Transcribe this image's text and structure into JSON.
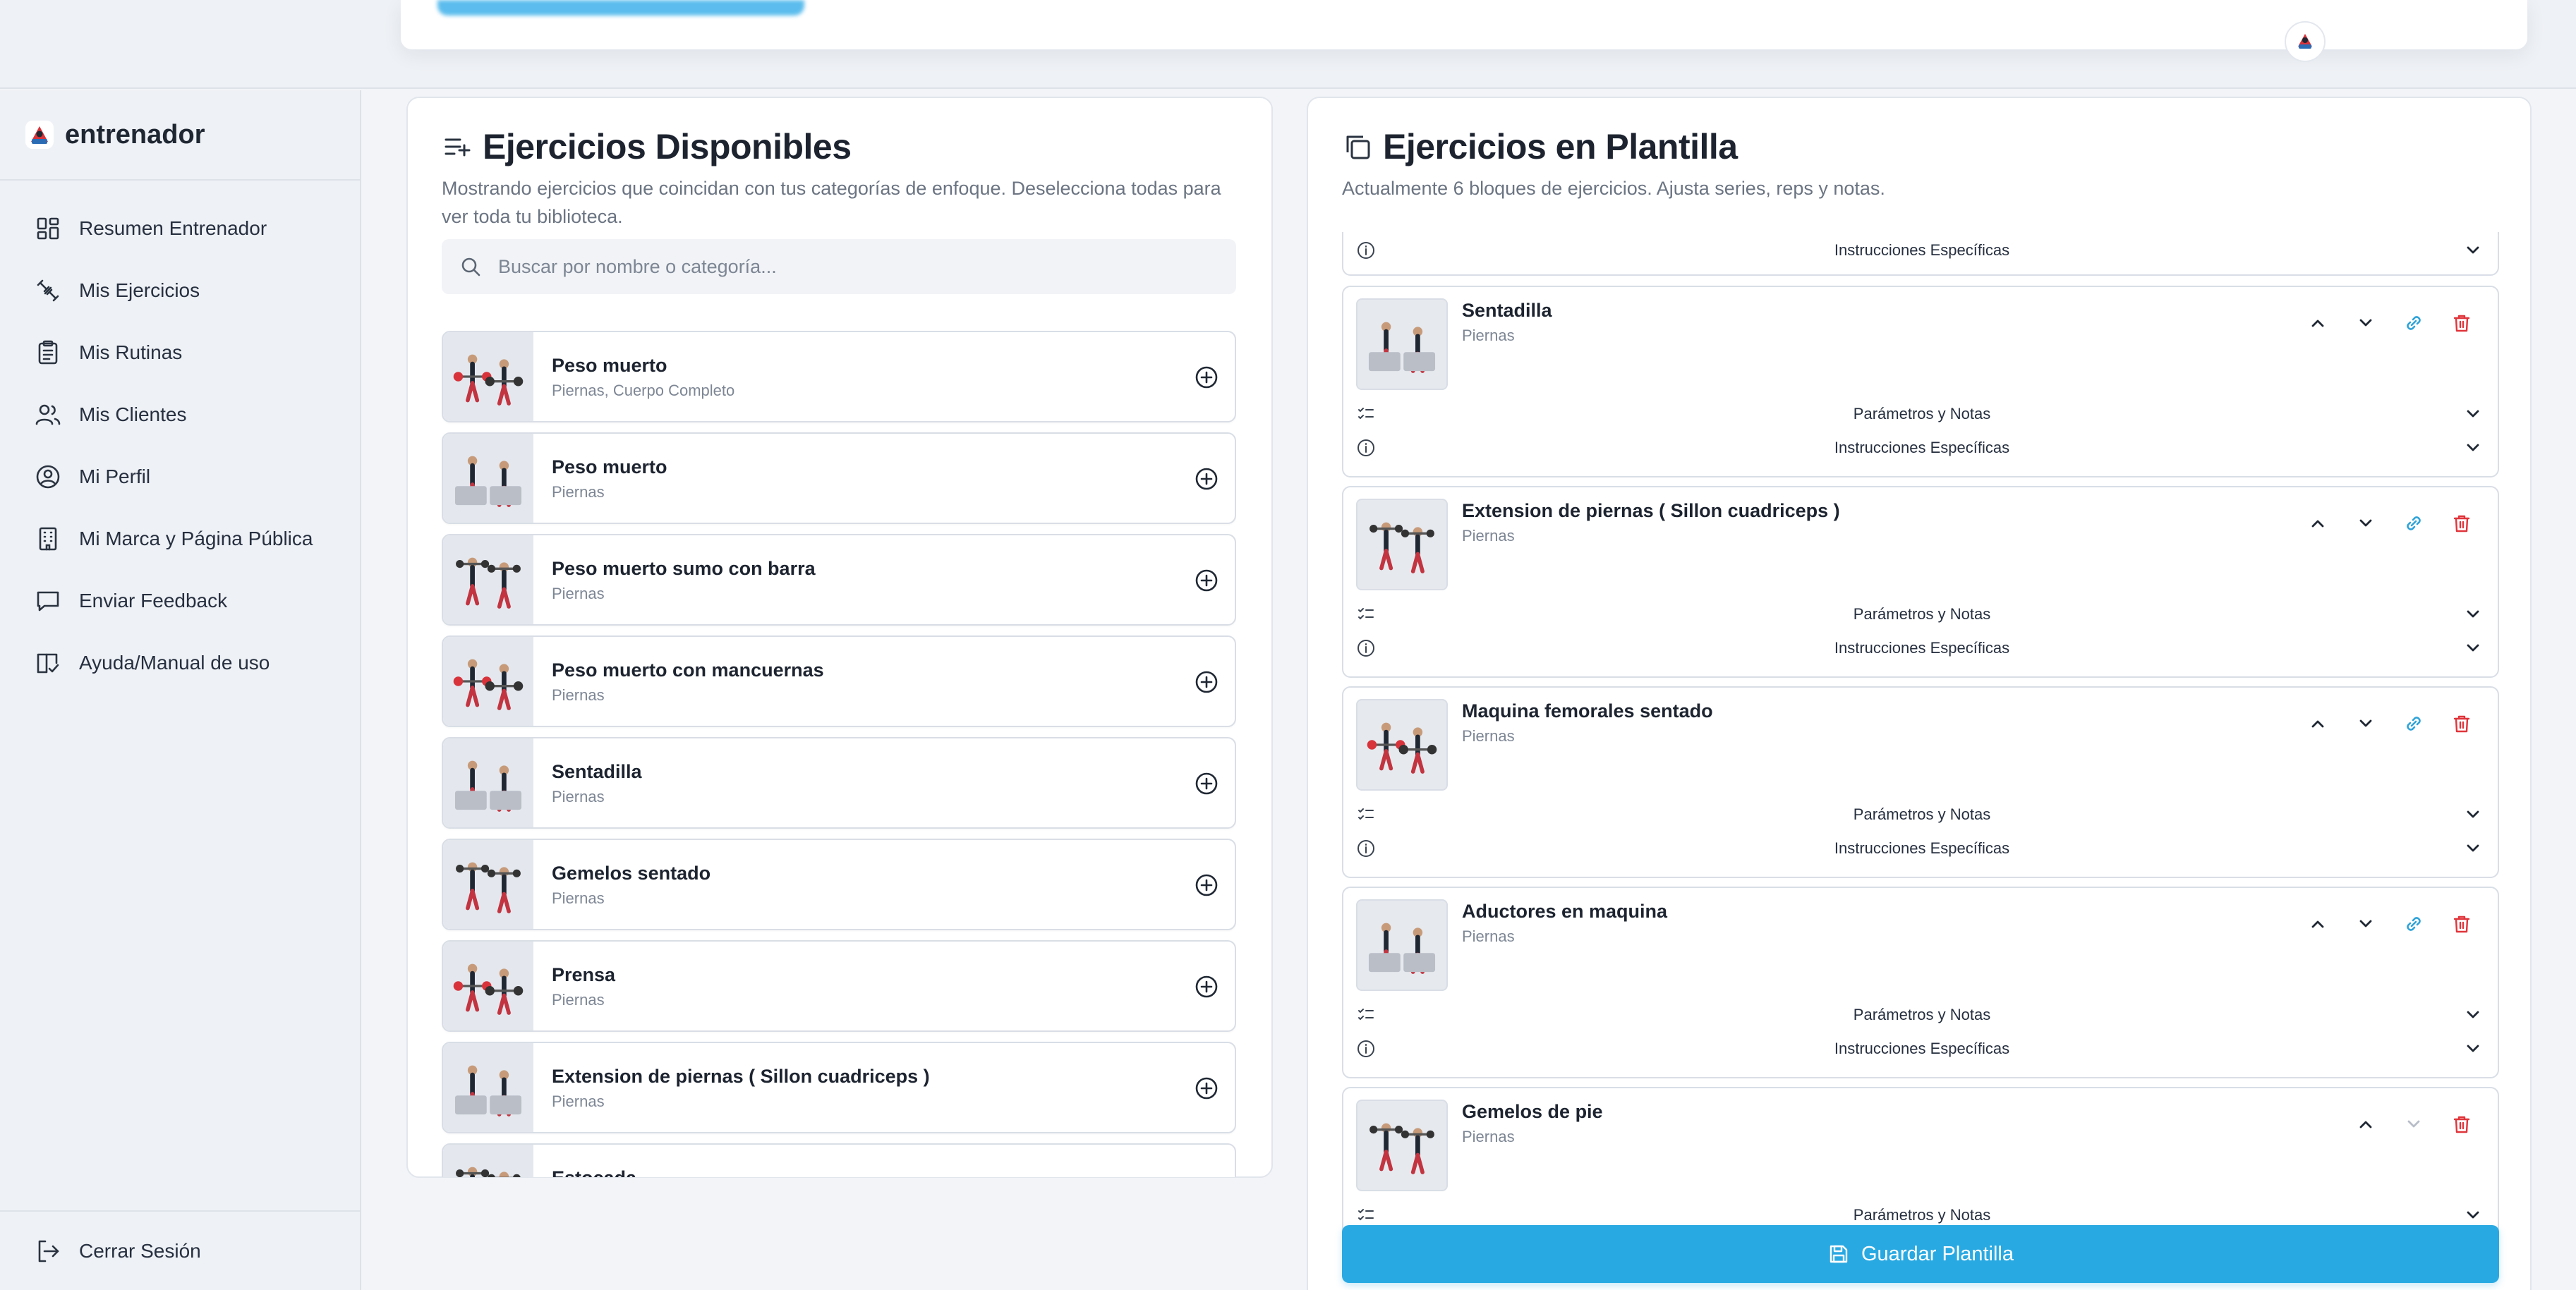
{
  "sidebar": {
    "brand": "entrenador",
    "items": [
      {
        "label": "Resumen Entrenador",
        "icon": "dashboard-icon"
      },
      {
        "label": "Mis Ejercicios",
        "icon": "exercise-icon"
      },
      {
        "label": "Mis Rutinas",
        "icon": "clipboard-icon"
      },
      {
        "label": "Mis Clientes",
        "icon": "users-icon"
      },
      {
        "label": "Mi Perfil",
        "icon": "user-circle-icon"
      },
      {
        "label": "Mi Marca y Página Pública",
        "icon": "building-icon"
      },
      {
        "label": "Enviar Feedback",
        "icon": "message-icon"
      },
      {
        "label": "Ayuda/Manual de uso",
        "icon": "book-icon"
      }
    ],
    "logout": "Cerrar Sesión"
  },
  "available": {
    "title": "Ejercicios Disponibles",
    "description_line1": "Mostrando ejercicios que coincidan con tus categorías de enfoque. Deselecciona todas para",
    "description_line2": "ver toda tu biblioteca.",
    "search_placeholder": "Buscar por nombre o categoría...",
    "exercises": [
      {
        "name": "Peso muerto",
        "category": "Piernas, Cuerpo Completo"
      },
      {
        "name": "Peso muerto",
        "category": "Piernas"
      },
      {
        "name": "Peso muerto sumo con barra",
        "category": "Piernas"
      },
      {
        "name": "Peso muerto con mancuernas",
        "category": "Piernas"
      },
      {
        "name": "Sentadilla",
        "category": "Piernas"
      },
      {
        "name": "Gemelos sentado",
        "category": "Piernas"
      },
      {
        "name": "Prensa",
        "category": "Piernas"
      },
      {
        "name": "Extension de piernas ( Sillon cuadriceps )",
        "category": "Piernas"
      },
      {
        "name": "Estocada",
        "category": ""
      }
    ]
  },
  "template": {
    "title": "Ejercicios en Plantilla",
    "description": "Actualmente 6 bloques de ejercicios. Ajusta series, reps y notas.",
    "params_label": "Parámetros y Notas",
    "instructions_label": "Instrucciones Específicas",
    "blocks": [
      {
        "name": "Sentadilla",
        "category": "Piernas"
      },
      {
        "name": "Extension de piernas ( Sillon cuadriceps )",
        "category": "Piernas"
      },
      {
        "name": "Maquina femorales sentado",
        "category": "Piernas"
      },
      {
        "name": "Aductores en maquina",
        "category": "Piernas"
      },
      {
        "name": "Gemelos de pie",
        "category": "Piernas"
      }
    ],
    "save_label": "Guardar Plantilla"
  },
  "colors": {
    "accent": "#29a9e2",
    "link": "#2fa3d9",
    "danger": "#e0353b"
  }
}
